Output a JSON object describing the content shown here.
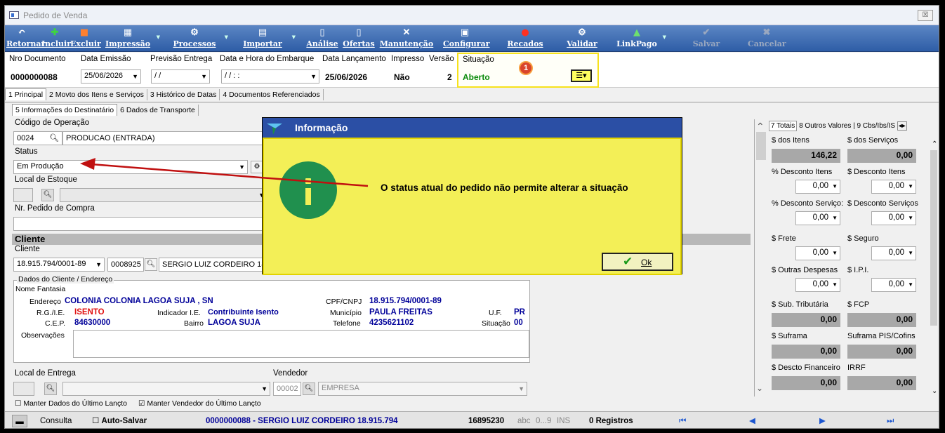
{
  "window": {
    "title": "Pedido de Venda",
    "close": "☒"
  },
  "toolbar": [
    {
      "label": "Retornar",
      "icon": "undo-icon",
      "glyph": "↶"
    },
    {
      "label": "Incluir",
      "icon": "plus-icon",
      "glyph": "✚"
    },
    {
      "label": "Excluir",
      "icon": "delete-icon",
      "glyph": "■"
    },
    {
      "label": "Impressão",
      "icon": "printer-icon",
      "glyph": "▦"
    },
    {
      "label": "Processos",
      "icon": "gears-icon",
      "glyph": "⚙"
    },
    {
      "label": "Importar",
      "icon": "import-icon",
      "glyph": "▤"
    },
    {
      "label": "Análise",
      "icon": "document-icon",
      "glyph": "▯"
    },
    {
      "label": "Ofertas",
      "icon": "document-icon",
      "glyph": "▯"
    },
    {
      "label": "Manutenção",
      "icon": "tools-icon",
      "glyph": "✕"
    },
    {
      "label": "Configurar",
      "icon": "settings-icon",
      "glyph": "▣"
    },
    {
      "label": "Recados",
      "icon": "message-icon",
      "glyph": "●"
    },
    {
      "label": "Validar",
      "icon": "validate-icon",
      "glyph": "⚙"
    },
    {
      "label": "LinkPago",
      "icon": "link-icon",
      "glyph": "▲"
    },
    {
      "label": "Salvar",
      "icon": "check-icon",
      "glyph": "✔"
    },
    {
      "label": "Cancelar",
      "icon": "x-icon",
      "glyph": "✖"
    }
  ],
  "header": {
    "nro_label": "Nro Documento",
    "nro_value": "0000000088",
    "emissao_label": "Data Emissão",
    "emissao_value": "25/06/2026",
    "previsao_label": "Previsão Entrega",
    "previsao_value": "/ /",
    "embarque_label": "Data e Hora do Embarque",
    "embarque_value": "/ / : :",
    "lancamento_label": "Data Lançamento",
    "lancamento_value": "25/06/2026",
    "impresso_label": "Impresso",
    "impresso_value": "Não",
    "versao_label": "Versão",
    "versao_value": "2",
    "situacao_label": "Situação",
    "situacao_value": "Aberto",
    "badge": "1"
  },
  "tabs1": [
    "1 Principal",
    "2 Movto dos Itens e Serviços",
    "3 Histórico de Datas",
    "4 Documentos Referenciados"
  ],
  "tabs2": [
    "5 Informações do Destinatário",
    "6 Dados de Transporte"
  ],
  "form": {
    "codop_label": "Código de Operação",
    "codop_code": "0024",
    "codop_desc": "PRODUCAO (ENTRADA)",
    "status_label": "Status",
    "status_value": "Em Produção",
    "local_label": "Local de Estoque",
    "pedido_label": "Nr. Pedido de Compra",
    "cliente_section": "Cliente",
    "cliente_label": "Cliente",
    "cliente_cnpj": "18.915.794/0001-89",
    "cliente_code": "0008925",
    "cliente_name": "SERGIO LUIZ CORDEIRO 18.9",
    "dados_legend": "Dados do Cliente / Endereço",
    "fantasia_label": "Nome Fantasia",
    "endereco_label": "Endereço",
    "endereco_value": "COLONIA COLONIA LAGOA SUJA , SN",
    "rg_label": "R.G./I.E.",
    "rg_value": "ISENTO",
    "ind_label": "Indicador I.E.",
    "ind_value": "Contribuinte Isento",
    "cep_label": "C.E.P.",
    "cep_value": "84630000",
    "bairro_label": "Bairro",
    "bairro_value": "LAGOA SUJA",
    "cpf_label": "CPF/CNPJ",
    "cpf_value": "18.915.794/0001-89",
    "mun_label": "Município",
    "mun_value": "PAULA FREITAS",
    "tel_label": "Telefone",
    "tel_value": "4235621102",
    "uf_label": "U.F.",
    "uf_value": "PR",
    "sit_label": "Situação",
    "sit_value": "00",
    "obs_label": "Observações",
    "entrega_label": "Local de Entrega",
    "vend_label": "Vendedor",
    "vend_code": "00002",
    "vend_name": "EMPRESA",
    "manter1": "Manter Dados do Último Lançto",
    "manter2": "Manter Vendedor do Último Lançto"
  },
  "right": {
    "tabs": [
      "7 Totais",
      "8 Outros Valores",
      "9 Cbs/Ibs/IS"
    ],
    "itens_label": "$ dos Itens",
    "itens_value": "146,22",
    "serv_label": "$ dos Serviços",
    "serv_value": "0,00",
    "pdi_label": "% Desconto Itens",
    "pdi_value": "0,00",
    "sdi_label": "$ Desconto Itens",
    "sdi_value": "0,00",
    "pds_label": "% Desconto Serviço:",
    "pds_value": "0,00",
    "sds_label": "$ Desconto Serviços",
    "sds_value": "0,00",
    "frete_label": "$ Frete",
    "frete_value": "0,00",
    "seguro_label": "$ Seguro",
    "seguro_value": "0,00",
    "outras_label": "$ Outras Despesas",
    "outras_value": "0,00",
    "ipi_label": "$ I.P.I.",
    "ipi_value": "0,00",
    "sub_label": "$ Sub. Tributária",
    "sub_value": "0,00",
    "fcp_label": "$ FCP",
    "fcp_value": "0,00",
    "suf_label": "$ Suframa",
    "suf_value": "0,00",
    "sufpc_label": "Suframa PIS/Cofins",
    "sufpc_value": "0,00",
    "desfin_label": "$ Descto Financeiro",
    "desfin_value": "0,00",
    "irrf_label": "IRRF",
    "irrf_value": "0,00"
  },
  "status": {
    "mode": "Consulta",
    "autosave": "Auto-Salvar",
    "doc": "0000000088 - SERGIO LUIZ CORDEIRO 18.915.794",
    "num": "16895230",
    "abc": "abc",
    "digits": "0...9",
    "ins": "INS",
    "registros": "0 Registros"
  },
  "dialog": {
    "title": "Informação",
    "message": "O status atual do pedido não permite alterar a situação",
    "ok": "Ok"
  }
}
